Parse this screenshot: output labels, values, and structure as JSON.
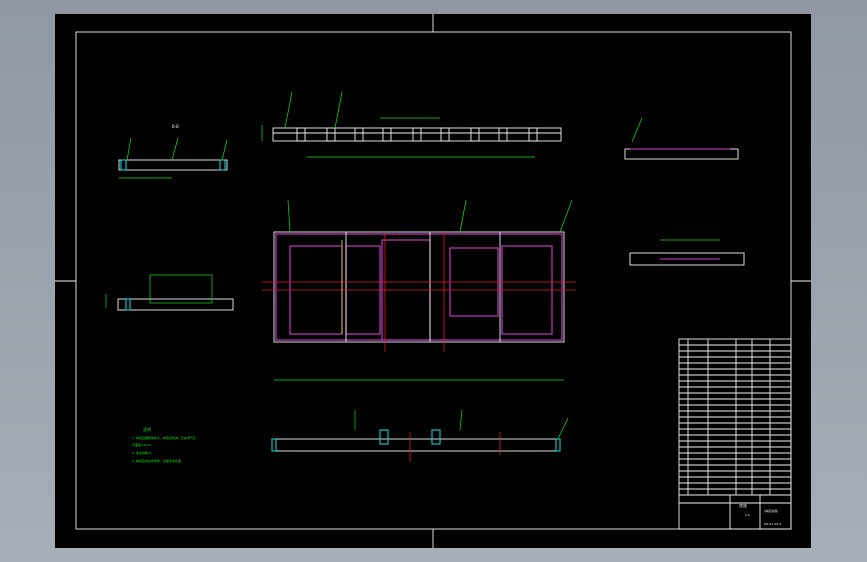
{
  "drawing": {
    "notes_title": "说明",
    "notes": [
      "1. 焊接后需整体校平，焊缝应饱满，无夹渣气孔",
      "   平面度≤1mm",
      "2. 未注倒角C1",
      "3. 焊接完成后去毛刺，表面喷漆处理"
    ],
    "section_labels": [
      "B-B",
      "A-A",
      "E-E",
      "C-C",
      "D-D",
      "F-F"
    ],
    "title_block": {
      "name": "底座",
      "part_no": "(焊接总成)",
      "drawing_no": "DZ-01-00-0",
      "scale": "1:5"
    }
  },
  "colors": {
    "sheet": "#000000",
    "frame": "#ffffff",
    "dim": "#18e018",
    "magenta": "#d040d0",
    "red": "#e02020",
    "cyan": "#19e0e0"
  }
}
